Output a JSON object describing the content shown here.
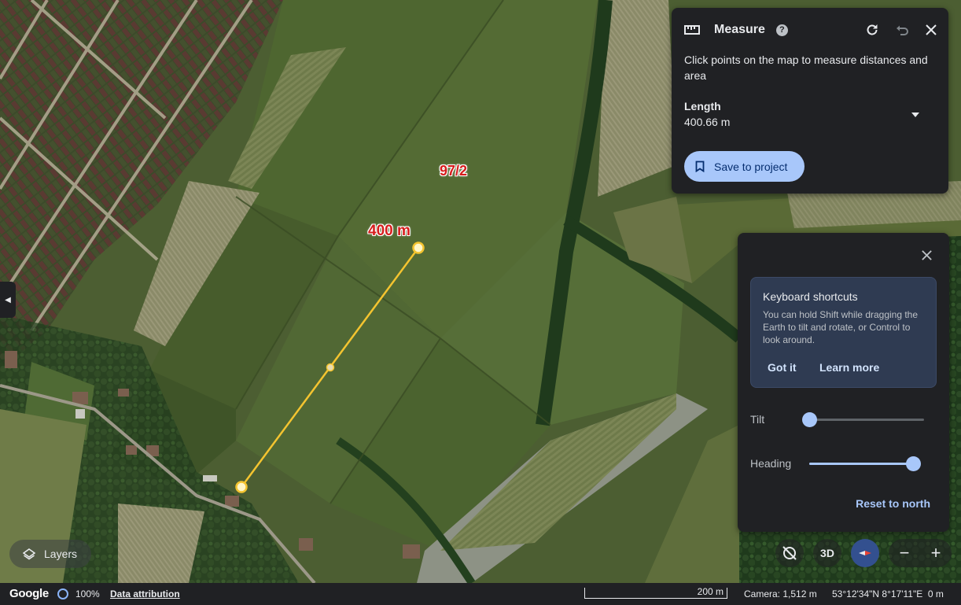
{
  "map": {
    "parcel_label": "97/2",
    "distance_label": "400 m"
  },
  "measure": {
    "title": "Measure",
    "instruction": "Click points on the map to measure distances and area",
    "length_label": "Length",
    "length_value": "400.66 m",
    "save_label": "Save to project"
  },
  "view_panel": {
    "shortcut_title": "Keyboard shortcuts",
    "shortcut_body": "You can hold Shift while dragging the Earth to tilt and rotate, or Control to look around.",
    "got_it_label": "Got it",
    "learn_more_label": "Learn more",
    "tilt_label": "Tilt",
    "tilt_value": 0,
    "heading_label": "Heading",
    "heading_value": 1,
    "reset_label": "Reset to north"
  },
  "controls": {
    "btn_3d_label": "3D",
    "zoom_out_label": "−",
    "zoom_in_label": "+"
  },
  "layers": {
    "label": "Layers"
  },
  "statusbar": {
    "logo": "Google",
    "load_percent": "100%",
    "attribution": "Data attribution",
    "scale": "200 m",
    "camera": "Camera: 1,512 m",
    "coords": "53°12'34\"N 8°17'11\"E  0 m"
  },
  "colors": {
    "accent": "#a8c7fa",
    "measure_line": "#f4c430",
    "label_red": "#d71c1c",
    "panel_bg": "#202124"
  }
}
